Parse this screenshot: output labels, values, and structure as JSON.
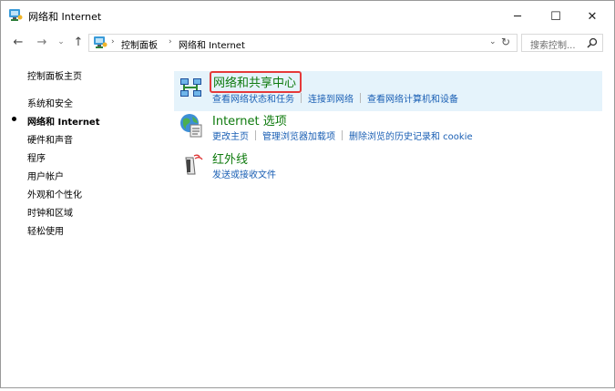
{
  "window": {
    "title": "网络和 Internet",
    "minimize_glyph": "─",
    "maximize_glyph": "☐",
    "close_glyph": "✕"
  },
  "nav": {
    "back_glyph": "←",
    "forward_glyph": "→",
    "recent_glyph": "⌄",
    "up_glyph": "↑"
  },
  "address": {
    "crumbs": [
      "控制面板",
      "网络和 Internet"
    ],
    "separator": "›",
    "dropdown_glyph": "⌄",
    "refresh_glyph": "↻"
  },
  "search": {
    "placeholder": "搜索控制..."
  },
  "sidebar": {
    "items": [
      {
        "label": "控制面板主页",
        "current": false
      },
      {
        "label": "系统和安全",
        "current": false
      },
      {
        "label": "网络和 Internet",
        "current": true
      },
      {
        "label": "硬件和声音",
        "current": false
      },
      {
        "label": "程序",
        "current": false
      },
      {
        "label": "用户帐户",
        "current": false
      },
      {
        "label": "外观和个性化",
        "current": false
      },
      {
        "label": "时钟和区域",
        "current": false
      },
      {
        "label": "轻松使用",
        "current": false
      }
    ]
  },
  "categories": [
    {
      "title": "网络和共享中心",
      "icon": "network-sharing-icon",
      "links": [
        "查看网络状态和任务",
        "连接到网络",
        "查看网络计算机和设备"
      ]
    },
    {
      "title": "Internet 选项",
      "icon": "internet-options-icon",
      "links": [
        "更改主页",
        "管理浏览器加载项",
        "删除浏览的历史记录和 cookie"
      ]
    },
    {
      "title": "红外线",
      "icon": "infrared-icon",
      "links": [
        "发送或接收文件"
      ]
    }
  ],
  "colors": {
    "category_title": "#0e7a0d",
    "link": "#1a5fb4",
    "highlight_bg": "#e5f3fb",
    "annotation_box": "#e53a3a"
  }
}
